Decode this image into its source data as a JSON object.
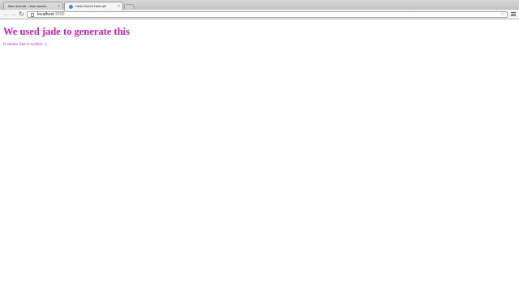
{
  "colors": {
    "page_text": "#c81fbc",
    "link_favicon": "#3d8fd6"
  },
  "tabs": [
    {
      "label": "Max Schmitt – Web develo",
      "favicon": "page-icon",
      "active": false
    },
    {
      "label": "Hello World! Hello all!",
      "favicon": "web-icon",
      "active": true
    }
  ],
  "toolbar": {
    "back_icon": "←",
    "forward_icon": "→",
    "reload_icon": "↻",
    "tab_close": "×",
    "star_icon": "☆"
  },
  "omnibox": {
    "host": "localhost",
    "port": ":3000"
  },
  "page": {
    "heading": "We used jade to generate this",
    "paragraph": "It seems like it works! :)"
  }
}
